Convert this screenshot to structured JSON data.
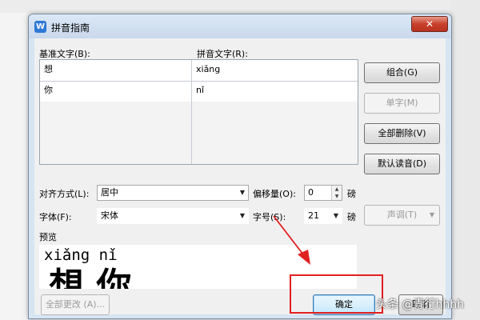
{
  "dialog": {
    "title": "拼音指南",
    "app_icon_letter": "W",
    "close_glyph": "✕"
  },
  "labels": {
    "base_text": "基准文字(B):",
    "pinyin_text": "拼音文字(R):",
    "align": "对齐方式(L):",
    "offset": "偏移量(O):",
    "offset_unit": "磅",
    "font": "字体(F):",
    "size": "字号(S):",
    "size_unit": "磅",
    "preview": "预览"
  },
  "grid_rows": [
    {
      "base": "想",
      "pinyin": "xiǎng"
    },
    {
      "base": "你",
      "pinyin": "nǐ"
    },
    {
      "base": "",
      "pinyin": ""
    },
    {
      "base": "",
      "pinyin": ""
    },
    {
      "base": "",
      "pinyin": ""
    }
  ],
  "buttons": {
    "combine": "组合(G)",
    "single": "单字(M)",
    "delete_all": "全部删除(V)",
    "default_reading": "默认读音(D)",
    "tone": "声调(T)",
    "change_all": "全部更改 (A)...",
    "ok": "确定",
    "cancel": "取消"
  },
  "fields": {
    "align_value": "居中",
    "offset_value": "0",
    "font_value": "宋体",
    "size_value": "21"
  },
  "preview": {
    "pinyin": "xiǎng nǐ",
    "chars": "想 你"
  },
  "watermark": "头条 @青行hhhh",
  "colors": {
    "highlight": "#e02020"
  }
}
